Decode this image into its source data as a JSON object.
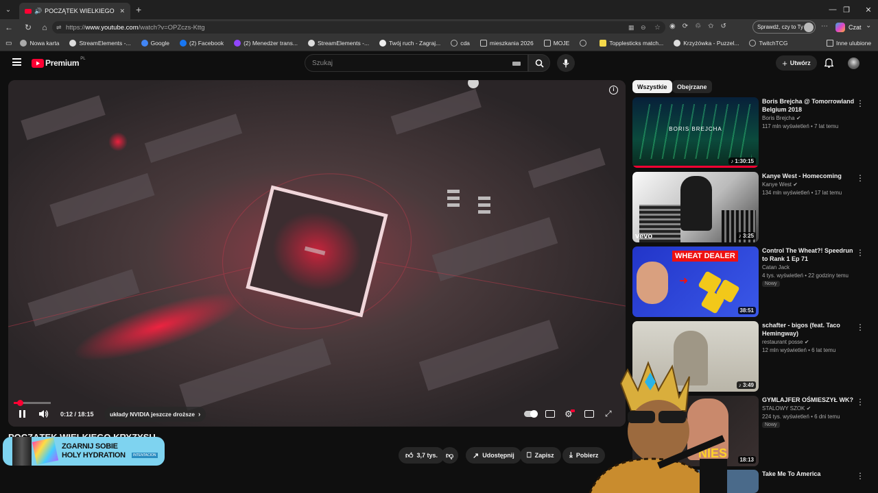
{
  "browser": {
    "tab_title": "POCZĄTEK WIELKIEGO KRYZY",
    "url_prefix": "https://",
    "url_domain": "www.youtube.com",
    "url_path": "/watch?v=OPZczs-Kttg",
    "profile_button": "Sprawdź, czy to Ty",
    "chat_label": "Czat",
    "bookmarks": [
      {
        "label": "Nowa karta",
        "icon": "new-tab-icon"
      },
      {
        "label": "StreamElements -...",
        "icon": "streamelements-icon"
      },
      {
        "label": "Google",
        "icon": "google-icon"
      },
      {
        "label": "(2) Facebook",
        "icon": "facebook-icon"
      },
      {
        "label": "(2) Menedżer trans...",
        "icon": "twitch-icon"
      },
      {
        "label": "StreamElements -...",
        "icon": "streamelements-icon"
      },
      {
        "label": "Twój ruch - Zagraj...",
        "icon": "chess-icon"
      },
      {
        "label": "cda",
        "icon": "globe-icon"
      },
      {
        "label": "mieszkania 2026",
        "icon": "folder-icon"
      },
      {
        "label": "MOJE",
        "icon": "folder-icon"
      },
      {
        "label": "",
        "icon": "globe-icon"
      },
      {
        "label": "Topplesticks match...",
        "icon": "folder-icon"
      },
      {
        "label": "Krzyżówka - Puzzel...",
        "icon": "puzzel-icon"
      },
      {
        "label": "TwitchTCG",
        "icon": "globe-icon"
      }
    ],
    "other_bookmarks": "Inne ulubione"
  },
  "youtube": {
    "logo_text": "Premium",
    "logo_sup": "PL",
    "search_placeholder": "Szukaj",
    "create_label": "Utwórz"
  },
  "player": {
    "time": "0:12 / 18:15",
    "chapter": "układy NVIDIA jeszcze droższe",
    "progress": 0.011,
    "video_title": "POCZĄTEK WIELKIEGO KRYZYSU",
    "actions": {
      "likes": "3,7 tys.",
      "share": "Udostępnij",
      "save": "Zapisz",
      "download": "Pobierz"
    }
  },
  "ad_banner": {
    "line1": "ZGARNIJ SOBIE",
    "line2": "HOLY HYDRATION",
    "brand": "INTENTACION"
  },
  "sidebar": {
    "chips": [
      "Wszystkie",
      "Obejrzane"
    ],
    "recommendations": [
      {
        "title": "Boris Brejcha @ Tomorrowland Belgium 2018",
        "channel": "Boris Brejcha",
        "meta": "117 mln wyświetleń • 7 lat temu",
        "duration": "1:30:15",
        "thumb_text": "BORIS BREJCHA",
        "badge": ""
      },
      {
        "title": "Kanye West - Homecoming",
        "channel": "Kanye West",
        "meta": "134 mln wyświetleń • 17 lat temu",
        "duration": "3:25",
        "thumb_text": "vevo",
        "badge": ""
      },
      {
        "title": "Control The Wheat?! Speedrun to Rank 1 Ep 71",
        "channel": "Catan Jack",
        "meta": "4 tys. wyświetleń • 22 godziny temu",
        "duration": "38:51",
        "thumb_text": "WHEAT DEALER",
        "badge": "Nowy"
      },
      {
        "title": "schafter - bigos (feat. Taco Hemingway)",
        "channel": "restaurant posse",
        "meta": "12 mln wyświetleń • 6 lat temu",
        "duration": "3:49",
        "thumb_text": "",
        "badge": ""
      },
      {
        "title": "GYMLAJFER OŚMIESZYŁ WK?",
        "channel": "STALOWY SZOK",
        "meta": "224 tys. wyświetleń • 6 dni temu",
        "duration": "18:13",
        "thumb_text": "NIES",
        "badge": "Nowy"
      },
      {
        "title": "Take Me To America",
        "channel": "",
        "meta": "",
        "duration": "",
        "thumb_text": "",
        "badge": ""
      }
    ]
  },
  "colors": {
    "yt_red": "#ff0033",
    "bg": "#0f0f0f",
    "chrome_dark": "#202020",
    "chrome_mid": "#353535",
    "ad_cyan": "#7ed3f0"
  }
}
